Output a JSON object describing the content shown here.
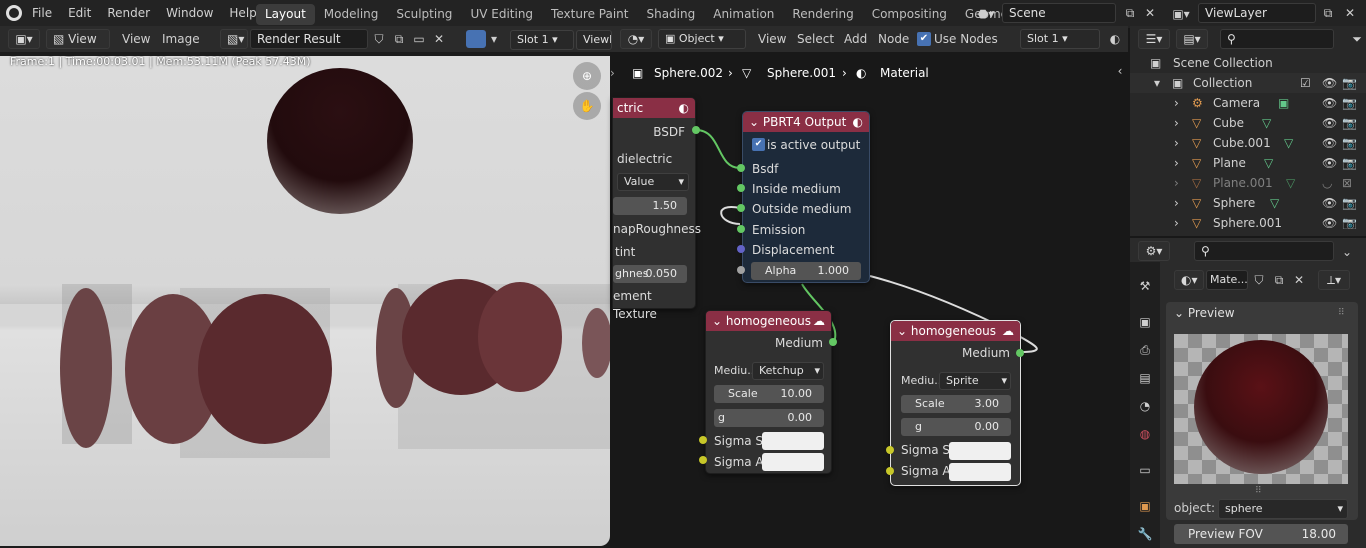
{
  "menu": {
    "file": "File",
    "edit": "Edit",
    "render": "Render",
    "window": "Window",
    "help": "Help"
  },
  "workspaces": [
    "Layout",
    "Modeling",
    "Sculpting",
    "UV Editing",
    "Texture Paint",
    "Shading",
    "Animation",
    "Rendering",
    "Compositing",
    "Geometry Noc"
  ],
  "scene": {
    "name": "Scene",
    "view_layer": "ViewLayer"
  },
  "image_editor": {
    "view_menu": "View",
    "view": "View",
    "image": "Image",
    "image_name": "Render Result",
    "slot": "Slot 1",
    "view_layer_trunc": "ViewL",
    "status": "Frame:1 | Time:00:03.01 | Mem:53.11M (Peak 57.43M)"
  },
  "node_editor": {
    "mode": "Object",
    "view": "View",
    "select": "Select",
    "add": "Add",
    "node": "Node",
    "use_nodes": "Use Nodes",
    "slot": "Slot 1",
    "breadcrumb": [
      "Sphere.002",
      "Sphere.001",
      "Material"
    ]
  },
  "node_left": {
    "title": "ctric",
    "bsdf": "BSDF",
    "dielectric": "dielectric",
    "value": "Value",
    "ior": "1.50",
    "remap": "napRoughness",
    "tint": "tint",
    "rough_lbl": "ghnes",
    "rough_val": "0.050",
    "ement": "ement Texture"
  },
  "pbrt_out": {
    "title": "PBRT4 Output",
    "active": "is active output",
    "bsdf": "Bsdf",
    "inside": "Inside medium",
    "outside": "Outside medium",
    "emission": "Emission",
    "displacement": "Displacement",
    "alpha_lbl": "Alpha",
    "alpha_val": "1.000"
  },
  "homog1": {
    "title": "homogeneous",
    "medium": "Medium",
    "medium_lbl": "Mediu...",
    "preset": "Ketchup",
    "scale_lbl": "Scale",
    "scale_val": "10.00",
    "g_lbl": "g",
    "g_val": "0.00",
    "sigma_s": "Sigma S",
    "sigma_a": "Sigma A"
  },
  "homog2": {
    "title": "homogeneous",
    "medium": "Medium",
    "medium_lbl": "Mediu...",
    "preset": "Sprite",
    "scale_lbl": "Scale",
    "scale_val": "3.00",
    "g_lbl": "g",
    "g_val": "0.00",
    "sigma_s": "Sigma S",
    "sigma_a": "Sigma A"
  },
  "outliner": {
    "scene_collection": "Scene Collection",
    "collection": "Collection",
    "items": [
      "Camera",
      "Cube",
      "Cube.001",
      "Plane",
      "Plane.001",
      "Sphere",
      "Sphere.001"
    ]
  },
  "properties": {
    "mat_name": "Mate...",
    "preview": "Preview",
    "object_lbl": "object:",
    "object_val": "sphere",
    "fov_lbl": "Preview FOV",
    "fov_val": "18.00"
  },
  "colors": {
    "accent": "#4772b3",
    "node_red": "#8a2f45",
    "socket_green": "#63c763",
    "socket_yellow": "#c7c729",
    "socket_gray": "#a1a1a1",
    "socket_purple": "#6363c7"
  }
}
